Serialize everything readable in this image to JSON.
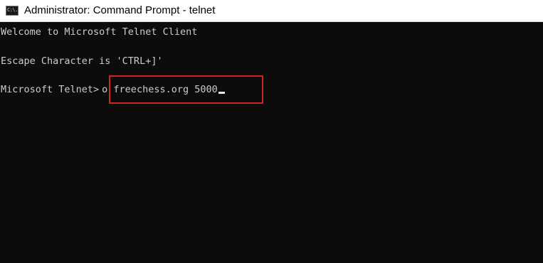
{
  "window": {
    "title": "Administrator: Command Prompt - telnet",
    "icon": "cmd-icon",
    "icon_glyph": "C:\\."
  },
  "terminal": {
    "welcome_line": "Welcome to Microsoft Telnet Client",
    "escape_line": "Escape Character is 'CTRL+]'",
    "prompt": "Microsoft Telnet>",
    "command": "o freechess.org 5000",
    "highlight_color": "#d22525",
    "background_color": "#0c0c0c",
    "text_color": "#cccccc"
  }
}
